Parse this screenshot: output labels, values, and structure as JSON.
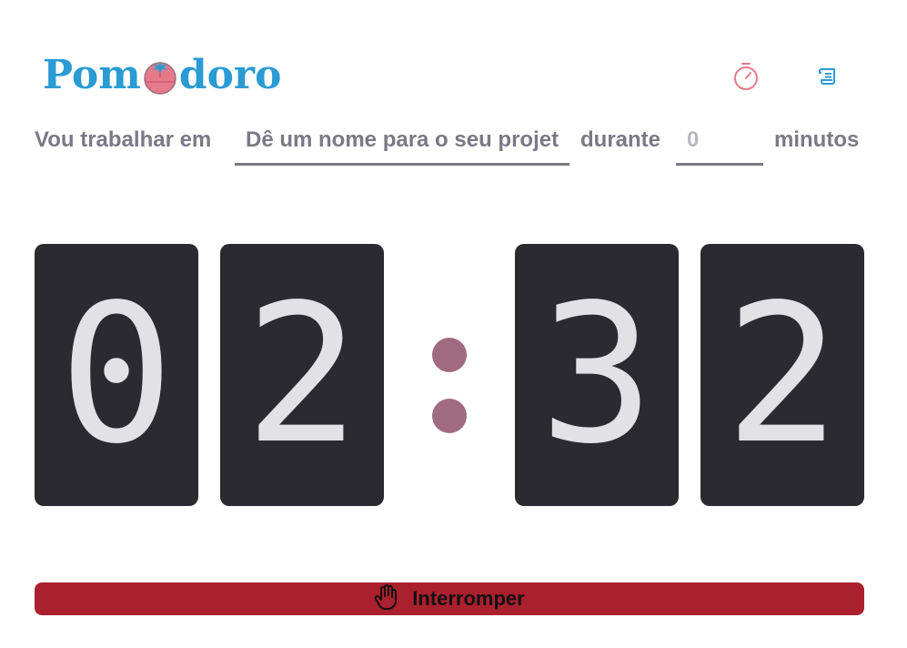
{
  "header": {
    "logo_text_left": "Pom",
    "logo_text_right": "doro",
    "icons": [
      "timer-icon",
      "history-scroll-icon"
    ]
  },
  "task": {
    "prefix": "Vou trabalhar em",
    "project_placeholder": "Dê um nome para o seu projeto",
    "project_value": "",
    "middle": "durante",
    "minutes_placeholder": "0",
    "suffix": "minutos"
  },
  "timer": {
    "minutes_tens": "0",
    "minutes_ones": "2",
    "seconds_tens": "3",
    "seconds_ones": "2"
  },
  "action": {
    "stop_label": "Interromper",
    "icon": "hand-palm-icon"
  },
  "colors": {
    "logo": "#2a9bd3",
    "card": "#2b2a30",
    "digit": "#e1e1e6",
    "colon": "#a06a80",
    "button": "#ab202d",
    "text": "#7a7985",
    "timer_icon": "#e57a8a",
    "history_icon": "#2a9bd3"
  }
}
